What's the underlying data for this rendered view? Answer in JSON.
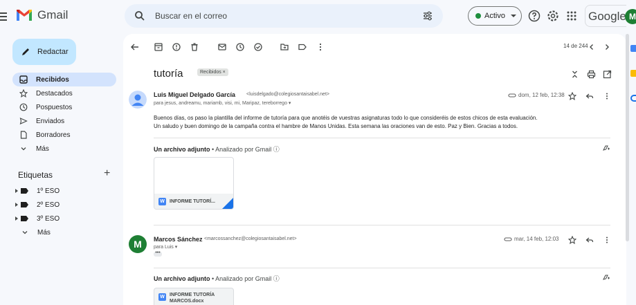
{
  "app": {
    "name": "Gmail",
    "brand": "Google"
  },
  "search": {
    "placeholder": "Buscar en el correo"
  },
  "status": {
    "label": "Activo"
  },
  "compose": {
    "label": "Redactar"
  },
  "nav": [
    {
      "label": "Recibidos",
      "icon": "inbox-icon",
      "active": true
    },
    {
      "label": "Destacados",
      "icon": "star-icon"
    },
    {
      "label": "Pospuestos",
      "icon": "clock-icon"
    },
    {
      "label": "Enviados",
      "icon": "send-icon"
    },
    {
      "label": "Borradores",
      "icon": "draft-icon"
    },
    {
      "label": "Más",
      "icon": "chevron-down-icon"
    }
  ],
  "labels": {
    "title": "Etiquetas",
    "add": "+",
    "items": [
      {
        "label": "1º ESO"
      },
      {
        "label": "2º ESO"
      },
      {
        "label": "3º ESO"
      }
    ],
    "more": "Más"
  },
  "thread": {
    "counter": "14 de 244",
    "subject": "tutoría",
    "label_chip": "Recibidos ×"
  },
  "messages": [
    {
      "sender": "Luis Miguel Delgado García",
      "email": "<luisdelgado@colegiosantaisabel.net>",
      "to": "para jesus, andreamu, mariamb, visi, mi, Maripaz, tereborrego ▾",
      "date": "dom, 12 feb, 12:38",
      "body1": "Buenos días, os paso la plantilla del informe de  tutoría para que anotéis de vuestras asignaturas todo lo que consideréis de estos chicos  de esta evaluación.",
      "body2": "Un saludo y buen domingo de la campaña contra el hambre de Manos Unidas. Esta semana las oraciones van de esto. Paz y Bien. Gracias a todos.",
      "attach_title": "Un archivo adjunto",
      "attach_scan": " • Analizado por Gmail ⓘ",
      "attach_name": "INFORME TUTORÍ..."
    },
    {
      "sender": "Marcos Sánchez",
      "avatar_letter": "M",
      "email": "<marcossanchez@colegiosantaisabel.net>",
      "to": "para Luis ▾",
      "date": "mar, 14 feb, 12:03",
      "ellipsis": "•••",
      "attach_title": "Un archivo adjunto",
      "attach_scan": " • Analizado por Gmail ⓘ",
      "attach_name_1": "INFORME TUTORÍA",
      "attach_name_2": "MARCOS.docx"
    }
  ],
  "avatar_top_letter": "M",
  "colors": {
    "accent": "#0b57d0",
    "compose": "#c2e7ff",
    "active_nav": "#d3e3fd",
    "status_green": "#1e8e3e",
    "avatar_green": "#1e7f34"
  }
}
